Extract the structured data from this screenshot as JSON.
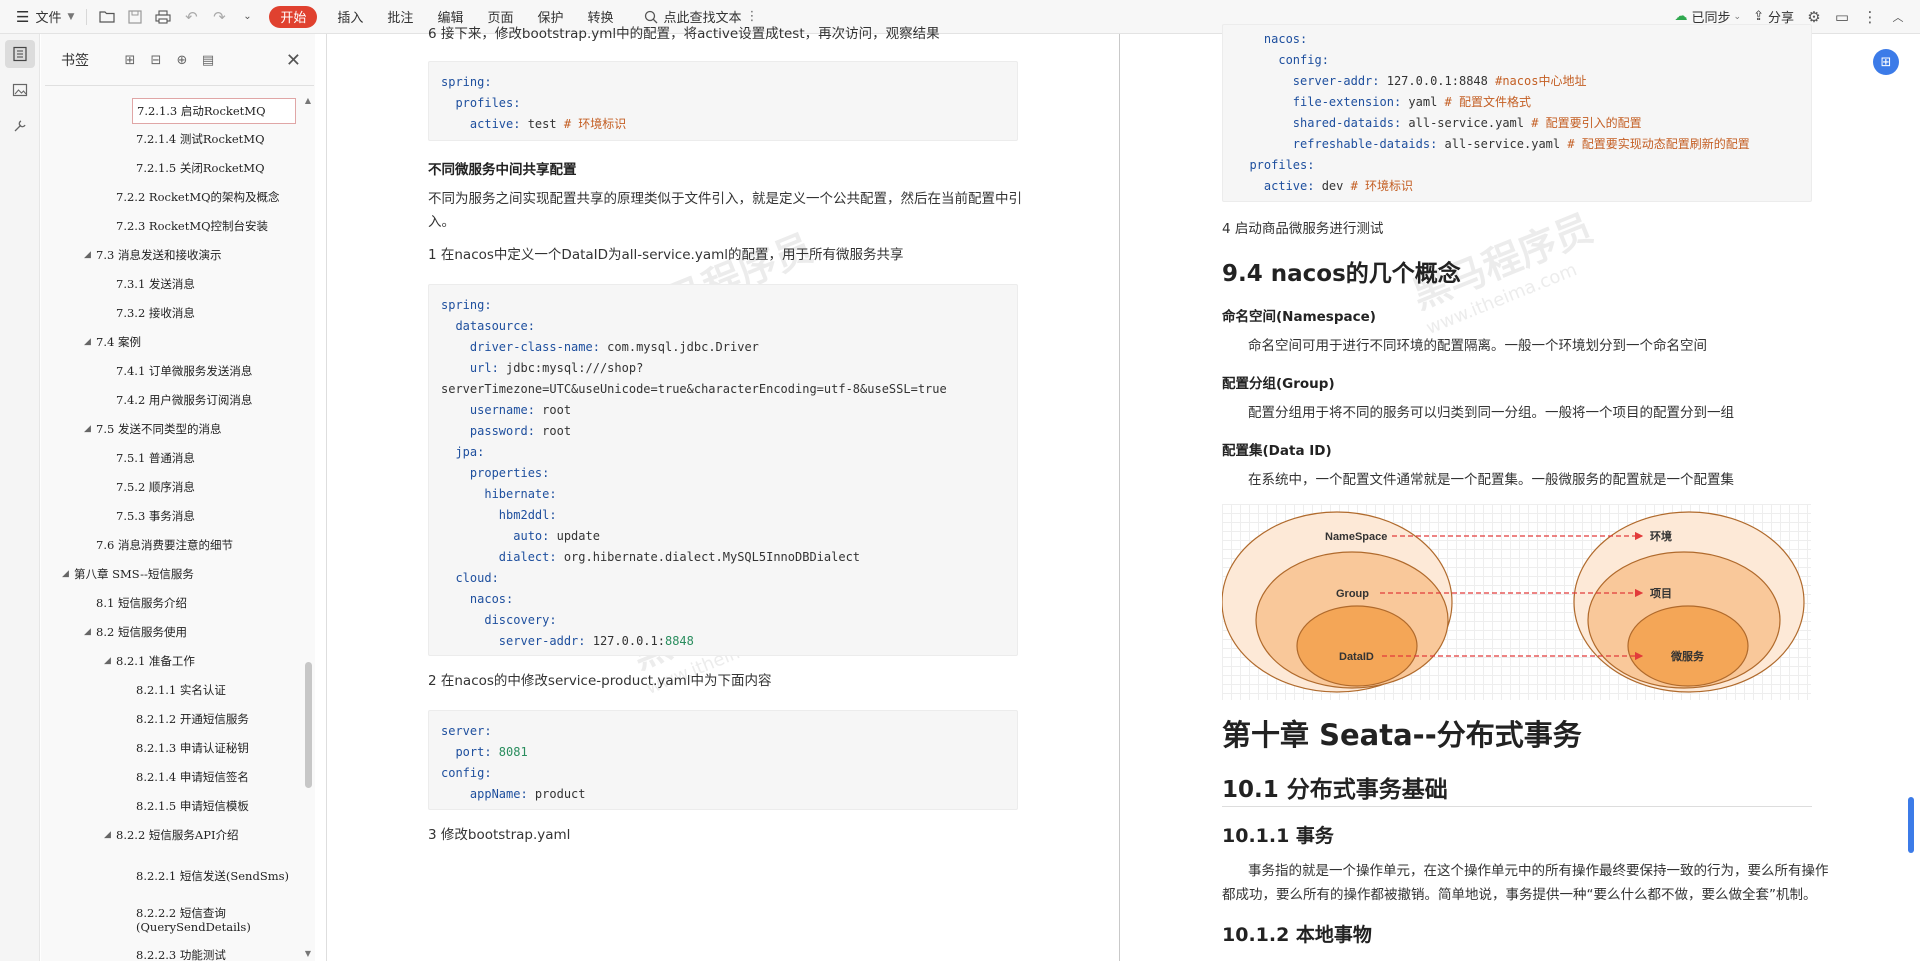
{
  "toolbar": {
    "file_label": "文件",
    "start_label": "开始",
    "menus": [
      "插入",
      "批注",
      "编辑",
      "页面",
      "保护",
      "转换"
    ],
    "search_label": "点此查找文本",
    "sync_label": "已同步",
    "share_label": "分享"
  },
  "bookmarks": {
    "title": "书签",
    "items": [
      {
        "label": "7.2.1.3 启动RocketMQ",
        "selected": true
      },
      {
        "label": "7.2.1.4 测试RocketMQ"
      },
      {
        "label": "7.2.1.5 关闭RocketMQ"
      },
      {
        "label": "7.2.2 RocketMQ的架构及概念"
      },
      {
        "label": "7.2.3 RocketMQ控制台安装"
      },
      {
        "label": "7.3 消息发送和接收演示"
      },
      {
        "label": "7.3.1 发送消息"
      },
      {
        "label": "7.3.2 接收消息"
      },
      {
        "label": "7.4 案例"
      },
      {
        "label": "7.4.1 订单微服务发送消息"
      },
      {
        "label": "7.4.2 用户微服务订阅消息"
      },
      {
        "label": "7.5 发送不同类型的消息"
      },
      {
        "label": "7.5.1 普通消息"
      },
      {
        "label": "7.5.2 顺序消息"
      },
      {
        "label": "7.5.3 事务消息"
      },
      {
        "label": "7.6 消息消费要注意的细节"
      },
      {
        "label": "第八章 SMS--短信服务"
      },
      {
        "label": "8.1 短信服务介绍"
      },
      {
        "label": "8.2 短信服务使用"
      },
      {
        "label": "8.2.1 准备工作"
      },
      {
        "label": "8.2.1.1 实名认证"
      },
      {
        "label": "8.2.1.2 开通短信服务"
      },
      {
        "label": "8.2.1.3 申请认证秘钥"
      },
      {
        "label": "8.2.1.4 申请短信签名"
      },
      {
        "label": "8.2.1.5 申请短信模板"
      },
      {
        "label": "8.2.2 短信服务API介绍"
      },
      {
        "label": "8.2.2.1 短信发送(SendSms)"
      },
      {
        "label": "8.2.2.2 短信查询(QuerySendDetails)"
      },
      {
        "label": "8.2.2.3 功能测试"
      }
    ]
  },
  "left_page": {
    "top_cut_text": "6 接下来，修改bootstrap.yml中的配置，将active设置成test，再次访问，观察结果",
    "code1": [
      {
        "k": "spring:",
        "v": "",
        "c": ""
      },
      {
        "k": "  profiles:",
        "v": "",
        "c": ""
      },
      {
        "k": "    active:",
        "v": " test ",
        "c": "# 环境标识"
      }
    ],
    "heading_share": "不同微服务中间共享配置",
    "para_share": "不同为服务之间实现配置共享的原理类似于文件引入，就是定义一个公共配置，然后在当前配置中引",
    "para_share2": "入。",
    "step1": "1 在nacos中定义一个DataID为all-service.yaml的配置，用于所有微服务共享",
    "code2": [
      {
        "k": "spring:",
        "v": ""
      },
      {
        "k": "  datasource:",
        "v": ""
      },
      {
        "k": "    driver-class-name:",
        "v": " com.mysql.jdbc.Driver"
      },
      {
        "k": "    url:",
        "v": " jdbc:mysql:///shop?"
      },
      {
        "k": "",
        "v": "serverTimezone=UTC&useUnicode=true&characterEncoding=utf-8&useSSL=true"
      },
      {
        "k": "    username:",
        "v": " root"
      },
      {
        "k": "    password:",
        "v": " root"
      },
      {
        "k": "  jpa:",
        "v": ""
      },
      {
        "k": "    properties:",
        "v": ""
      },
      {
        "k": "      hibernate:",
        "v": ""
      },
      {
        "k": "        hbm2ddl:",
        "v": ""
      },
      {
        "k": "          auto:",
        "v": " update"
      },
      {
        "k": "        dialect:",
        "v": " org.hibernate.dialect.MySQL5InnoDBDialect"
      },
      {
        "k": "  cloud:",
        "v": ""
      },
      {
        "k": "    nacos:",
        "v": ""
      },
      {
        "k": "      discovery:",
        "v": ""
      },
      {
        "k": "        server-addr:",
        "v": " 127.0.0.1:",
        "n": "8848"
      }
    ],
    "step2": "2 在nacos的中修改service-product.yaml中为下面内容",
    "code3": [
      {
        "k": "server:",
        "v": ""
      },
      {
        "k": "  port:",
        "v": "",
        "n": " 8081"
      },
      {
        "k": "config:",
        "v": ""
      },
      {
        "k": "    appName:",
        "v": " product"
      }
    ],
    "step3": "3 修改bootstrap.yaml"
  },
  "right_page": {
    "code_top": [
      {
        "k": "    nacos:",
        "v": "",
        "c": ""
      },
      {
        "k": "      config:",
        "v": "",
        "c": ""
      },
      {
        "k": "        server-addr:",
        "v": " 127.0.0.1:8848 ",
        "c": "#nacos中心地址"
      },
      {
        "k": "        file-extension:",
        "v": " yaml ",
        "c": "# 配置文件格式"
      },
      {
        "k": "        shared-dataids:",
        "v": " all-service.yaml ",
        "c": "# 配置要引入的配置"
      },
      {
        "k": "        refreshable-dataids:",
        "v": " all-service.yaml ",
        "c": "# 配置要实现动态配置刷新的配置"
      },
      {
        "k": "  profiles:",
        "v": "",
        "c": ""
      },
      {
        "k": "    active:",
        "v": " dev ",
        "c": "# 环境标识"
      }
    ],
    "step4": "4 启动商品微服务进行测试",
    "h_94": "9.4 nacos的几个概念",
    "ns_title": "命名空间(Namespace)",
    "ns_text": "命名空间可用于进行不同环境的配置隔离。一般一个环境划分到一个命名空间",
    "group_title": "配置分组(Group)",
    "group_text": "配置分组用于将不同的服务可以归类到同一分组。一般将一个项目的配置分到一组",
    "dataid_title": "配置集(Data ID)",
    "dataid_text": "在系统中，一个配置文件通常就是一个配置集。一般微服务的配置就是一个配置集",
    "diagram": {
      "left_labels": [
        "NameSpace",
        "Group",
        "DataID"
      ],
      "right_labels": [
        "环境",
        "项目",
        "微服务"
      ]
    },
    "h_ch10": "第十章 Seata--分布式事务",
    "h_101": "10.1 分布式事务基础",
    "h_1011": "10.1.1 事务",
    "tx_text1": "事务指的就是一个操作单元，在这个操作单元中的所有操作最终要保持一致的行为，要么所有操作",
    "tx_text2": "都成功，要么所有的操作都被撤销。简单地说，事务提供一种“要么什么都不做，要么做全套”机制。",
    "h_1012": "10.1.2 本地事物"
  },
  "watermark": {
    "cn": "黑马程序员",
    "en": "www.itheima.com"
  },
  "colors": {
    "accent": "#e0412f",
    "code_key": "#1e4f9e",
    "code_comment": "#c45f24",
    "code_number": "#2a8d5e",
    "blue": "#3c7be8"
  }
}
